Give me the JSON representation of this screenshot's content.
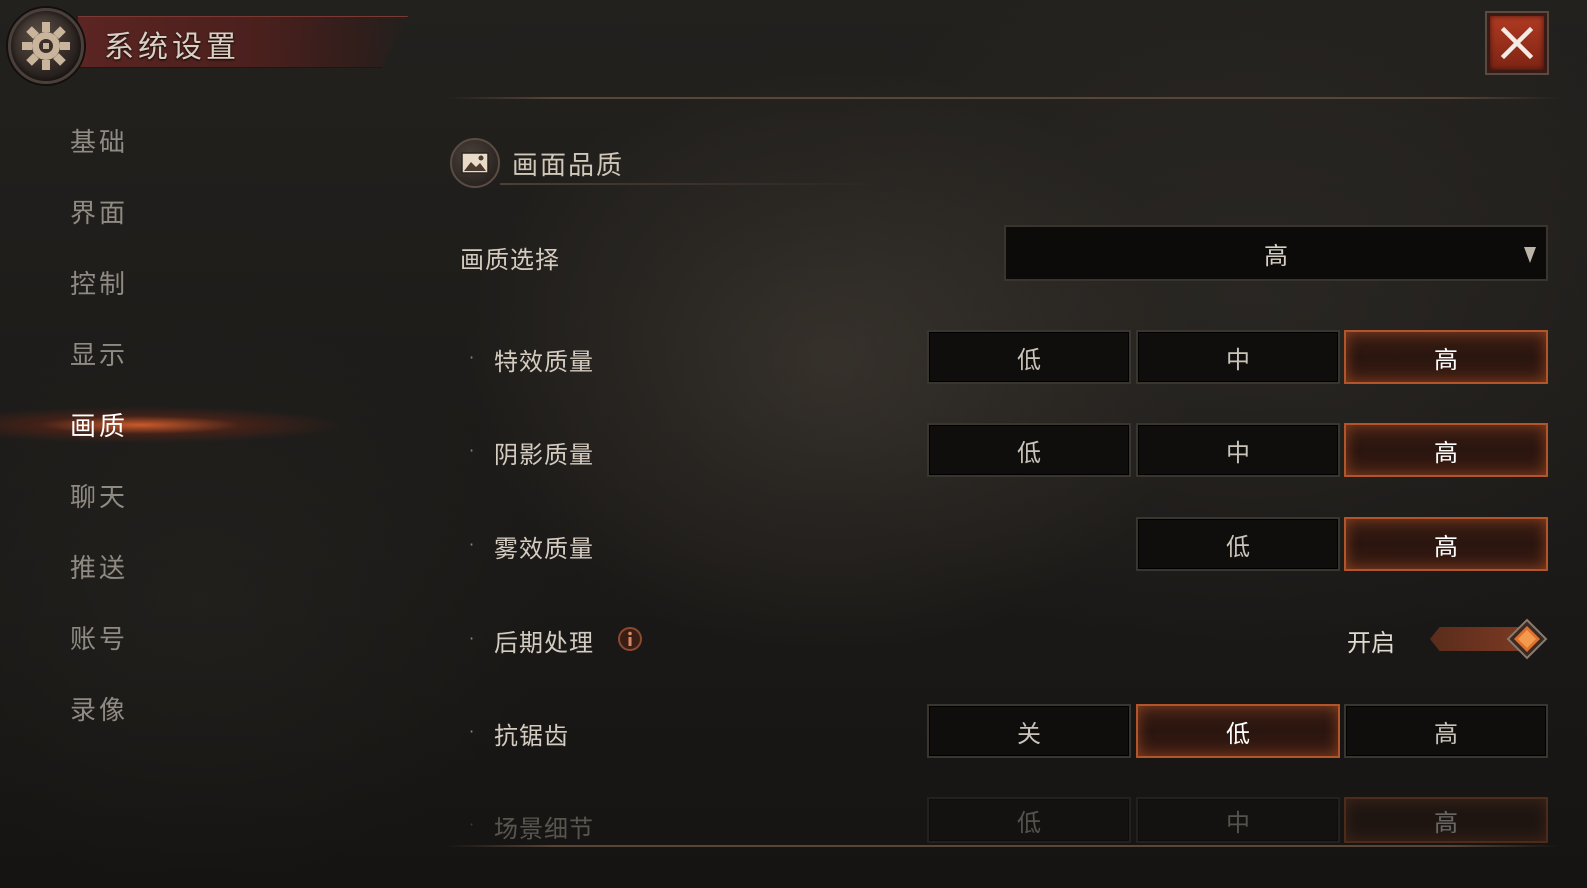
{
  "title": "系统设置",
  "colors": {
    "accent": "#b2552a",
    "close": "#9a2f1a",
    "active_glow": "#e8642d"
  },
  "sidebar": {
    "items": [
      {
        "label": "基础",
        "active": false
      },
      {
        "label": "界面",
        "active": false
      },
      {
        "label": "控制",
        "active": false
      },
      {
        "label": "显示",
        "active": false
      },
      {
        "label": "画质",
        "active": true
      },
      {
        "label": "聊天",
        "active": false
      },
      {
        "label": "推送",
        "active": false
      },
      {
        "label": "账号",
        "active": false
      },
      {
        "label": "录像",
        "active": false
      }
    ]
  },
  "section": {
    "title": "画面品质",
    "icon": "image-icon"
  },
  "quality_select": {
    "label": "画质选择",
    "value": "高"
  },
  "settings": {
    "effects": {
      "label": "特效质量",
      "options": [
        "低",
        "中",
        "高"
      ],
      "selected": "高"
    },
    "shadow": {
      "label": "阴影质量",
      "options": [
        "低",
        "中",
        "高"
      ],
      "selected": "高"
    },
    "fog": {
      "label": "雾效质量",
      "options": [
        "低",
        "高"
      ],
      "selected": "高"
    },
    "post": {
      "label": "后期处理",
      "state": "开启",
      "enabled": true
    },
    "aa": {
      "label": "抗锯齿",
      "options": [
        "关",
        "低",
        "高"
      ],
      "selected": "低"
    },
    "scene": {
      "label": "场景细节",
      "options": [
        "低",
        "中",
        "高"
      ],
      "selected": "高"
    }
  }
}
